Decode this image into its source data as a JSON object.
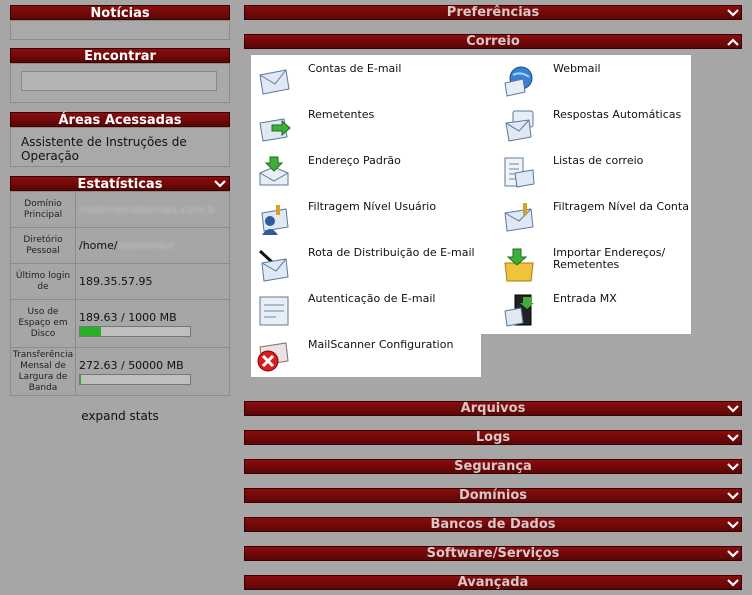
{
  "left": {
    "news_title": "Notícias",
    "find_title": "Encontrar",
    "areas_title": "Áreas Acessadas",
    "areas_item": "Assistente de Instruções de Operação",
    "stats_title": "Estatísticas",
    "stats": [
      {
        "label": "Domínio Principal",
        "value": "mobimecolitemas.com.b"
      },
      {
        "label": "Diretório Pessoal",
        "value_prefix": "/home/",
        "value_blurred": "nolimmtur"
      },
      {
        "label": "Último login de",
        "value": "189.35.57.95"
      },
      {
        "label": "Uso de Espaço em Disco",
        "value": "189.63 / 1000 MB",
        "fraction": 0.19
      },
      {
        "label": "Transferência Mensal de Largura de Banda",
        "value": "272.63 / 50000 MB",
        "fraction": 0.005
      }
    ],
    "expand_stats": "expand stats"
  },
  "right": {
    "preferences": "Preferências",
    "mail": "Correio",
    "mail_items": [
      {
        "label": "Contas de E-mail",
        "icon": "envelope-icon"
      },
      {
        "label": "Webmail",
        "icon": "webmail-globe-icon"
      },
      {
        "label": "Remetentes",
        "icon": "forward-envelope-icon"
      },
      {
        "label": "Respostas Automáticas",
        "icon": "autoresponder-icon"
      },
      {
        "label": "Endereço Padrão",
        "icon": "default-address-icon"
      },
      {
        "label": "Listas de correio",
        "icon": "mailing-list-icon"
      },
      {
        "label": "Filtragem Nível Usuário",
        "icon": "user-filter-icon"
      },
      {
        "label": "Filtragem Nível da Conta",
        "icon": "account-filter-icon"
      },
      {
        "label": "Rota de Distribuição de E-mail",
        "icon": "email-routing-icon"
      },
      {
        "label": "Importar Endereços/ Remetentes",
        "icon": "import-icon"
      },
      {
        "label": "Autenticação de E-mail",
        "icon": "email-auth-icon"
      },
      {
        "label": "Entrada MX",
        "icon": "mx-server-icon"
      },
      {
        "label": "MailScanner Configuration",
        "icon": "mailscanner-icon"
      }
    ],
    "sections": [
      "Arquivos",
      "Logs",
      "Segurança",
      "Domínios",
      "Bancos de Dados",
      "Software/Serviços",
      "Avançada"
    ]
  },
  "colors": {
    "bar": "#7a0a0a",
    "background": "#a6a6a6",
    "progress": "#29b02a"
  }
}
